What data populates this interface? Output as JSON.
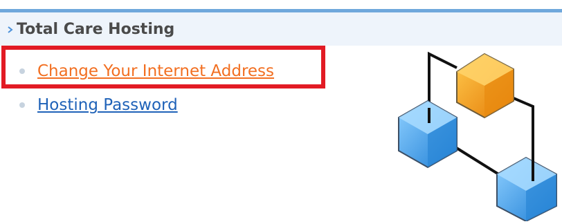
{
  "section": {
    "title": "Total Care Hosting"
  },
  "links": [
    {
      "label": "Change Your Internet Address",
      "color": "#f26f21",
      "highlighted": true
    },
    {
      "label": "Hosting Password",
      "color": "#1f62b8",
      "highlighted": false
    }
  ],
  "colors": {
    "accent_rule": "#6fa8dc",
    "header_bg": "#eef4fb",
    "highlight_border": "#e21b24",
    "cube_orange": "#f7a51c",
    "cube_blue": "#3b9ce6"
  },
  "icons": {
    "header": "chevron-right-icon",
    "illustration": "network-cubes-icon"
  }
}
